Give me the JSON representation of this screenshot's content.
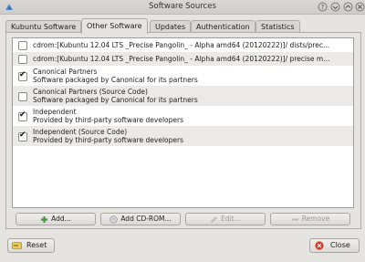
{
  "window": {
    "title": "Software Sources"
  },
  "tabs": [
    {
      "label": "Kubuntu Software"
    },
    {
      "label": "Other Software"
    },
    {
      "label": "Updates"
    },
    {
      "label": "Authentication"
    },
    {
      "label": "Statistics"
    }
  ],
  "active_tab": "Other Software",
  "sources": [
    {
      "line1": "cdrom:[Kubuntu 12.04 LTS _Precise Pangolin_ - Alpha amd64 (20120222)]/ dists/prec...",
      "line2": "",
      "checked": false
    },
    {
      "line1": "cdrom:[Kubuntu 12.04 LTS _Precise Pangolin_ - Alpha amd64 (20120222)]/ precise m...",
      "line2": "",
      "checked": false
    },
    {
      "line1": "Canonical Partners",
      "line2": "Software packaged by Canonical for its partners",
      "checked": true
    },
    {
      "line1": "Canonical Partners (Source Code)",
      "line2": "Software packaged by Canonical for its partners",
      "checked": false
    },
    {
      "line1": "Independent",
      "line2": "Provided by third-party software developers",
      "checked": true
    },
    {
      "line1": "Independent (Source Code)",
      "line2": "Provided by third-party software developers",
      "checked": false
    }
  ],
  "buttons": {
    "add": "Add...",
    "add_cdrom": "Add CD-ROM...",
    "edit": "Edit...",
    "remove": "Remove",
    "reset": "Reset",
    "close": "Close"
  },
  "colors": {
    "add_icon": "#3e9b2f",
    "close_icon": "#d23a2a",
    "checkmark": "#111111"
  }
}
